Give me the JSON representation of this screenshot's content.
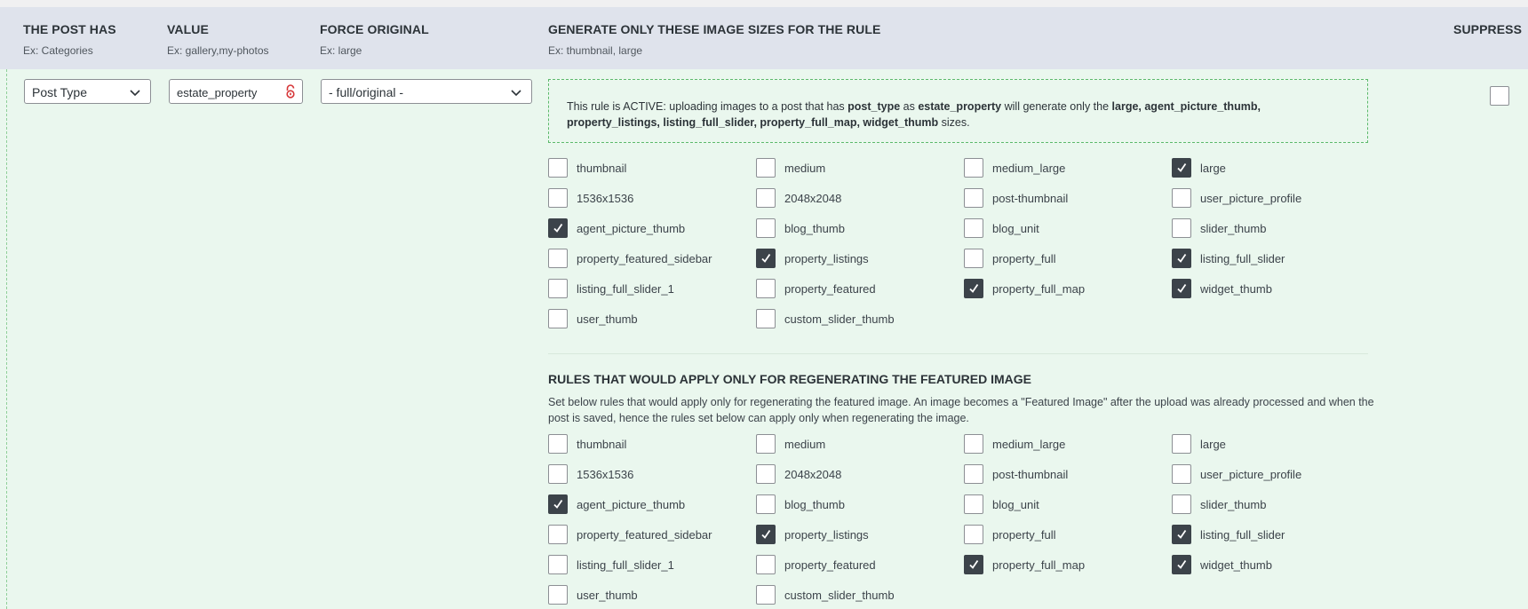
{
  "columns": {
    "post_has": {
      "title": "THE POST HAS",
      "hint": "Ex: Categories"
    },
    "value": {
      "title": "VALUE",
      "hint": "Ex: gallery,my-photos"
    },
    "force_original": {
      "title": "FORCE ORIGINAL",
      "hint": "Ex: large"
    },
    "sizes": {
      "title": "GENERATE ONLY THESE IMAGE SIZES FOR THE RULE",
      "hint": "Ex: thumbnail, large"
    },
    "suppress": {
      "title": "SUPPRESS"
    }
  },
  "rule": {
    "post_has_value": "Post Type",
    "value_input": "estate_property",
    "force_original_value": "- full/original -",
    "suppress_checked": false
  },
  "notice": {
    "t1": "This rule is ACTIVE: uploading images to a post that has ",
    "b1": "post_type",
    "t2": " as ",
    "b2": "estate_property",
    "t3": " will generate only the ",
    "b3": "large, agent_picture_thumb,",
    "b4": "property_listings, listing_full_slider, property_full_map, widget_thumb",
    "t4": " sizes."
  },
  "sizes_grid": [
    {
      "label": "thumbnail",
      "checked": false
    },
    {
      "label": "medium",
      "checked": false
    },
    {
      "label": "medium_large",
      "checked": false
    },
    {
      "label": "large",
      "checked": true
    },
    {
      "label": "1536x1536",
      "checked": false
    },
    {
      "label": "2048x2048",
      "checked": false
    },
    {
      "label": "post-thumbnail",
      "checked": false
    },
    {
      "label": "user_picture_profile",
      "checked": false
    },
    {
      "label": "agent_picture_thumb",
      "checked": true
    },
    {
      "label": "blog_thumb",
      "checked": false
    },
    {
      "label": "blog_unit",
      "checked": false
    },
    {
      "label": "slider_thumb",
      "checked": false
    },
    {
      "label": "property_featured_sidebar",
      "checked": false
    },
    {
      "label": "property_listings",
      "checked": true
    },
    {
      "label": "property_full",
      "checked": false
    },
    {
      "label": "listing_full_slider",
      "checked": true
    },
    {
      "label": "listing_full_slider_1",
      "checked": false
    },
    {
      "label": "property_featured",
      "checked": false
    },
    {
      "label": "property_full_map",
      "checked": true
    },
    {
      "label": "widget_thumb",
      "checked": true
    },
    {
      "label": "user_thumb",
      "checked": false
    },
    {
      "label": "custom_slider_thumb",
      "checked": false
    }
  ],
  "featured_section": {
    "title": "RULES THAT WOULD APPLY ONLY FOR REGENERATING THE FEATURED IMAGE",
    "description": "Set below rules that would apply only for regenerating the featured image. An image becomes a \"Featured Image\" after the upload was already processed and when the post is saved, hence the rules set below can apply only when regenerating the image."
  },
  "featured_grid": [
    {
      "label": "thumbnail",
      "checked": false
    },
    {
      "label": "medium",
      "checked": false
    },
    {
      "label": "medium_large",
      "checked": false
    },
    {
      "label": "large",
      "checked": false
    },
    {
      "label": "1536x1536",
      "checked": false
    },
    {
      "label": "2048x2048",
      "checked": false
    },
    {
      "label": "post-thumbnail",
      "checked": false
    },
    {
      "label": "user_picture_profile",
      "checked": false
    },
    {
      "label": "agent_picture_thumb",
      "checked": true
    },
    {
      "label": "blog_thumb",
      "checked": false
    },
    {
      "label": "blog_unit",
      "checked": false
    },
    {
      "label": "slider_thumb",
      "checked": false
    },
    {
      "label": "property_featured_sidebar",
      "checked": false
    },
    {
      "label": "property_listings",
      "checked": true
    },
    {
      "label": "property_full",
      "checked": false
    },
    {
      "label": "listing_full_slider",
      "checked": true
    },
    {
      "label": "listing_full_slider_1",
      "checked": false
    },
    {
      "label": "property_featured",
      "checked": false
    },
    {
      "label": "property_full_map",
      "checked": true
    },
    {
      "label": "widget_thumb",
      "checked": true
    },
    {
      "label": "user_thumb",
      "checked": false
    },
    {
      "label": "custom_slider_thumb",
      "checked": false
    }
  ],
  "icons": {
    "dropdown": "chevron-down-icon",
    "lock": "lock-icon",
    "check": "check-icon"
  },
  "colors": {
    "header_bg": "#dfe3ec",
    "row_bg": "#eaf7ee",
    "notice_border": "#5cb96b",
    "checked_box": "#3c434a",
    "lock": "#d63638"
  }
}
